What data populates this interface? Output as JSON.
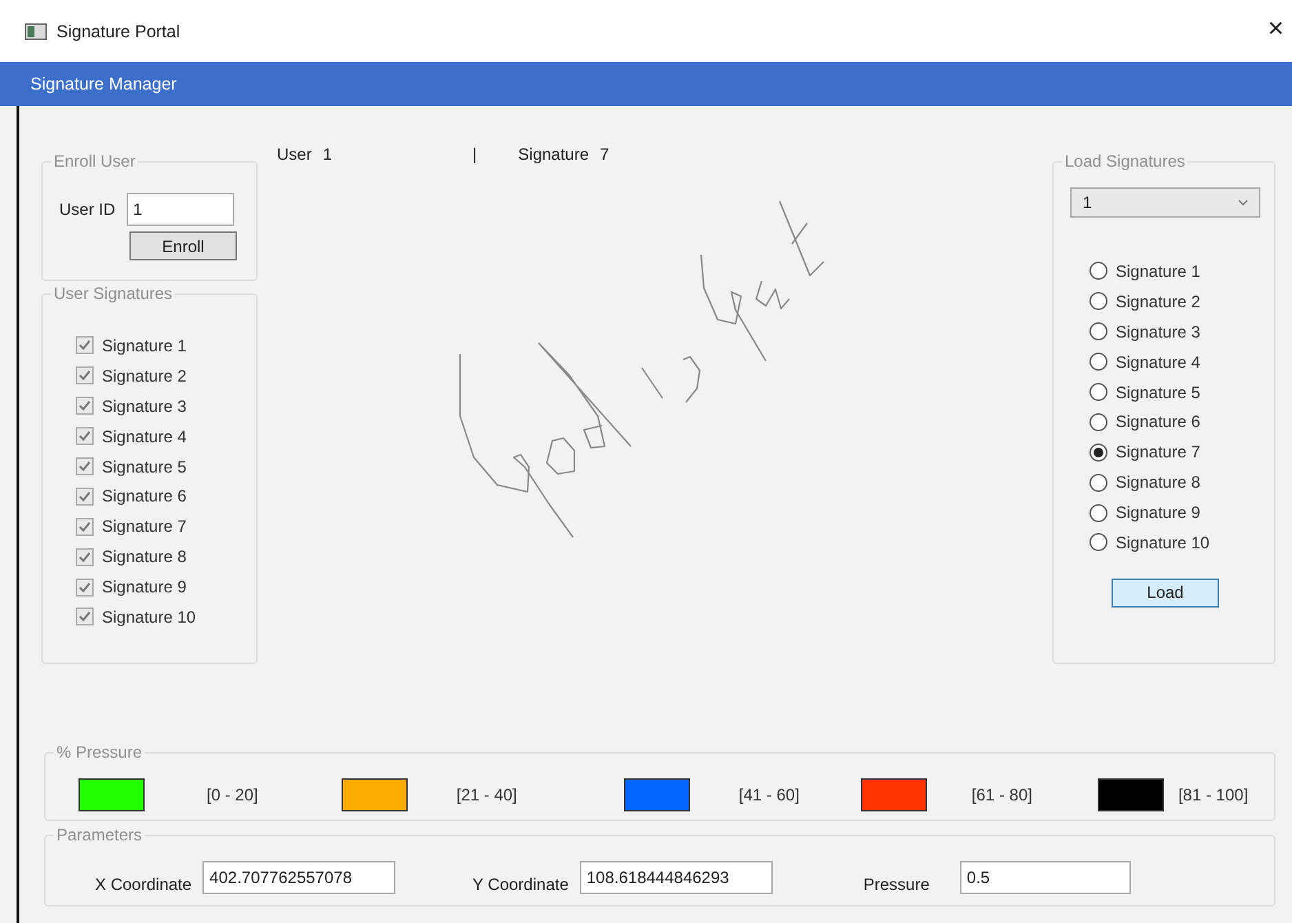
{
  "window": {
    "title": "Signature Portal",
    "close": "×"
  },
  "header": {
    "title": "Signature Manager"
  },
  "enroll_user": {
    "legend": "Enroll User",
    "user_id_label": "User ID",
    "user_id_value": "1",
    "button": "Enroll"
  },
  "user_signatures": {
    "legend": "User Signatures",
    "items": [
      {
        "label": "Signature 1",
        "checked": true
      },
      {
        "label": "Signature 2",
        "checked": true
      },
      {
        "label": "Signature 3",
        "checked": true
      },
      {
        "label": "Signature 4",
        "checked": true
      },
      {
        "label": "Signature 5",
        "checked": true
      },
      {
        "label": "Signature 6",
        "checked": true
      },
      {
        "label": "Signature 7",
        "checked": true
      },
      {
        "label": "Signature 8",
        "checked": true
      },
      {
        "label": "Signature 9",
        "checked": true
      },
      {
        "label": "Signature 10",
        "checked": true
      }
    ]
  },
  "status": {
    "user_label": "User",
    "user_value": "1",
    "separator": "|",
    "signature_label": "Signature",
    "signature_value": "7"
  },
  "load_signatures": {
    "legend": "Load Signatures",
    "dropdown_value": "1",
    "items": [
      {
        "label": "Signature 1",
        "selected": false
      },
      {
        "label": "Signature 2",
        "selected": false
      },
      {
        "label": "Signature 3",
        "selected": false
      },
      {
        "label": "Signature 4",
        "selected": false
      },
      {
        "label": "Signature 5",
        "selected": false
      },
      {
        "label": "Signature 6",
        "selected": false
      },
      {
        "label": "Signature 7",
        "selected": true
      },
      {
        "label": "Signature 8",
        "selected": false
      },
      {
        "label": "Signature 9",
        "selected": false
      },
      {
        "label": "Signature 10",
        "selected": false
      }
    ],
    "button": "Load"
  },
  "pressure": {
    "legend": "% Pressure",
    "items": [
      {
        "label": "[0 - 20]",
        "color": "#22ff00"
      },
      {
        "label": "[21 - 40]",
        "color": "#ffaa00"
      },
      {
        "label": "[41 - 60]",
        "color": "#0066ff"
      },
      {
        "label": "[61 - 80]",
        "color": "#ff3300"
      },
      {
        "label": "[81 - 100]",
        "color": "#000000"
      }
    ]
  },
  "parameters": {
    "legend": "Parameters",
    "fields": [
      {
        "label": "X Coordinate",
        "value": "402.707762557078"
      },
      {
        "label": "Y Coordinate",
        "value": "108.618444846293"
      },
      {
        "label": "Pressure",
        "value": "0.5"
      }
    ]
  }
}
